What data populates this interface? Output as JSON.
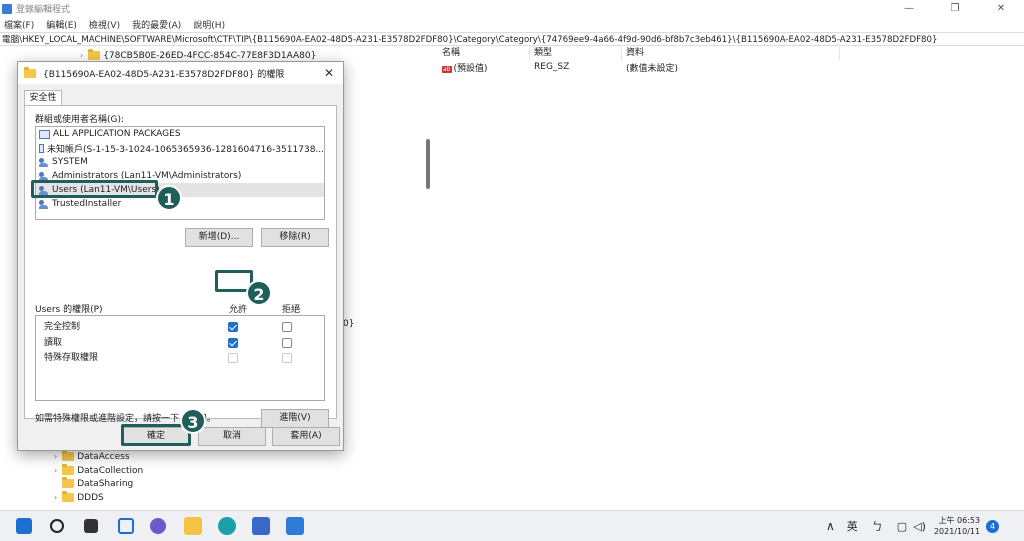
{
  "app": {
    "title": "登錄編輯程式",
    "minimize": "—",
    "maximize": "❐",
    "close": "✕"
  },
  "menu": [
    "檔案(F)",
    "編輯(E)",
    "檢視(V)",
    "我的最愛(A)",
    "說明(H)"
  ],
  "address": "電腦\\HKEY_LOCAL_MACHINE\\SOFTWARE\\Microsoft\\CTF\\TIP\\{B115690A-EA02-48D5-A231-E3578D2FDF80}\\Category\\Category\\{74769ee9-4a66-4f9d-90d6-bf8b7c3eb461}\\{B115690A-EA02-48D5-A231-E3578D2FDF80}",
  "tree": {
    "top_item": "{78CB5B0E-26ED-4FCC-854C-77E8F3D1AA80}",
    "partial": "0}",
    "items": [
      "DataAccess",
      "DataCollection",
      "DataSharing",
      "DDDS"
    ]
  },
  "values": {
    "headers": [
      "名稱",
      "類型",
      "資料"
    ],
    "rows": [
      {
        "icon": "ab",
        "name": "(預設值)",
        "type": "REG_SZ",
        "data": "(數值未設定)"
      }
    ]
  },
  "dialog": {
    "title": "{B115690A-EA02-48D5-A231-E3578D2FDF80} 的權限",
    "tab": "安全性",
    "group_label": "群組或使用者名稱(G):",
    "principals": [
      "ALL APPLICATION PACKAGES",
      "未知帳戶(S-1-15-3-1024-1065365936-1281604716-3511738...",
      "SYSTEM",
      "Administrators (Lan11-VM\\Administrators)",
      "Users (Lan11-VM\\Users)",
      "TrustedInstaller"
    ],
    "add_button": "新增(D)...",
    "remove_button": "移除(R)",
    "perm_label": "Users 的權限(P)",
    "allow": "允許",
    "deny": "拒絕",
    "permissions": [
      {
        "name": "完全控制",
        "allow": true,
        "deny": false,
        "disabled": false
      },
      {
        "name": "讀取",
        "allow": true,
        "deny": false,
        "disabled": false
      },
      {
        "name": "特殊存取權限",
        "allow": false,
        "deny": false,
        "disabled": true
      }
    ],
    "advanced_hint": "如需特殊權限或進階設定，請按一下 [進階]。",
    "advanced_button": "進階(V)",
    "ok_button": "確定",
    "cancel_button": "取消",
    "apply_button": "套用(A)"
  },
  "callouts": [
    "1",
    "2",
    "3"
  ],
  "colors": {
    "callout": "#1f5e5a",
    "checkbox": "#1f6fcc"
  },
  "taskbar": {
    "ime": "英",
    "time": "上午 06:53",
    "date": "2021/10/11",
    "notifications": "4"
  }
}
